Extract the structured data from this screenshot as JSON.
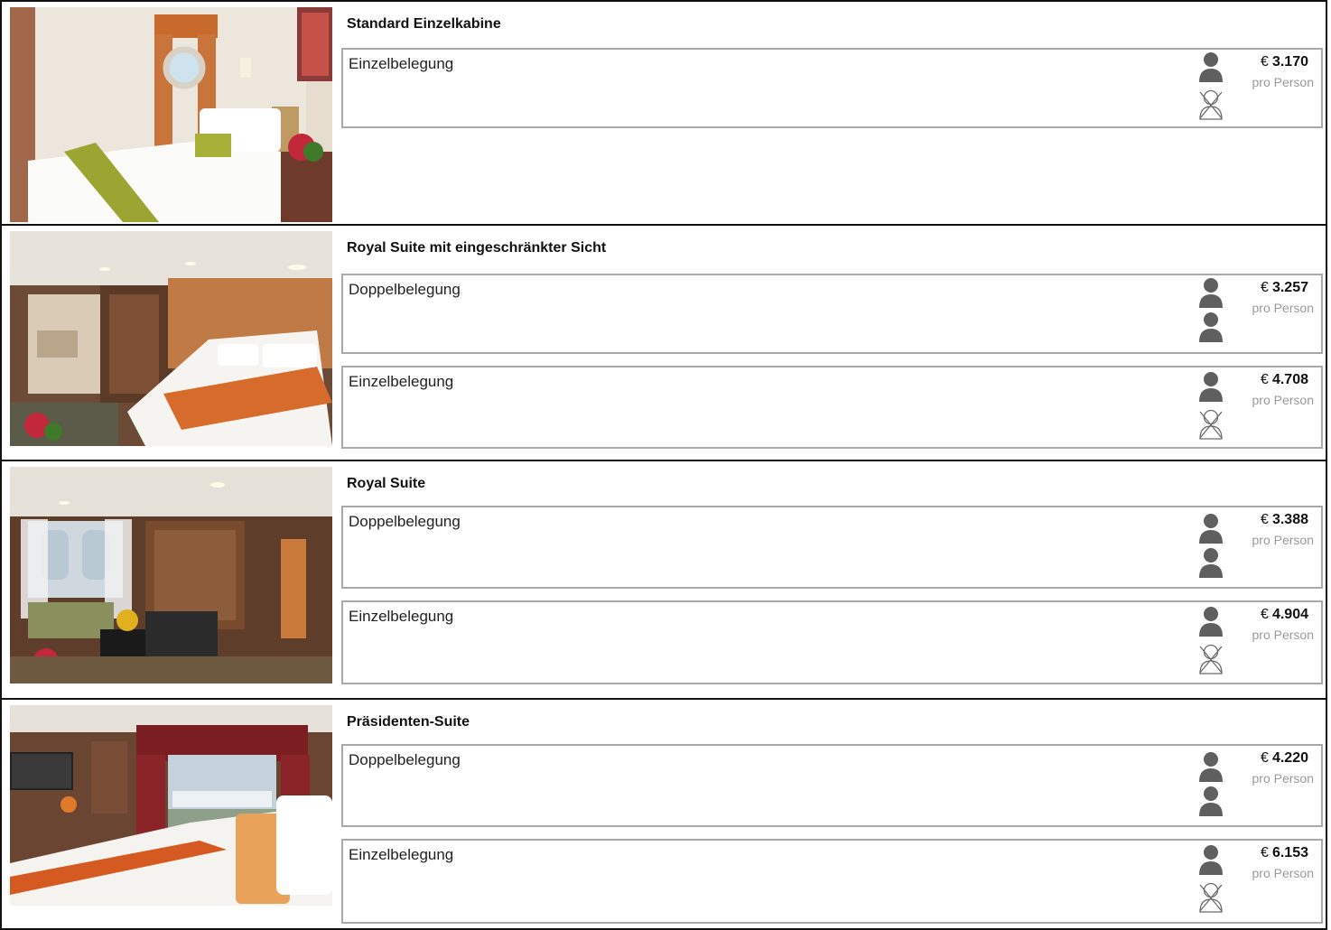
{
  "icons": {
    "person": "person-icon",
    "no_person": "no-person-icon"
  },
  "colors": {
    "person": "#5f5f5f",
    "option_border": "#a9a9a9",
    "per_person": "#9a9a9a"
  },
  "cabins": [
    {
      "title": "Standard Einzelkabine",
      "options": [
        {
          "label": "Einzelbelegung",
          "occupancy": [
            "person",
            "no_person"
          ],
          "currency": "€",
          "price": "3.170",
          "per": "pro Person"
        }
      ]
    },
    {
      "title": "Royal Suite mit eingeschränkter Sicht",
      "options": [
        {
          "label": "Doppelbelegung",
          "occupancy": [
            "person",
            "person"
          ],
          "currency": "€",
          "price": "3.257",
          "per": "pro Person"
        },
        {
          "label": "Einzelbelegung",
          "occupancy": [
            "person",
            "no_person"
          ],
          "currency": "€",
          "price": "4.708",
          "per": "pro Person"
        }
      ]
    },
    {
      "title": "Royal Suite",
      "options": [
        {
          "label": "Doppelbelegung",
          "occupancy": [
            "person",
            "person"
          ],
          "currency": "€",
          "price": "3.388",
          "per": "pro Person"
        },
        {
          "label": "Einzelbelegung",
          "occupancy": [
            "person",
            "no_person"
          ],
          "currency": "€",
          "price": "4.904",
          "per": "pro Person"
        }
      ]
    },
    {
      "title": "Präsidenten-Suite",
      "options": [
        {
          "label": "Doppelbelegung",
          "occupancy": [
            "person",
            "person"
          ],
          "currency": "€",
          "price": "4.220",
          "per": "pro Person"
        },
        {
          "label": "Einzelbelegung",
          "occupancy": [
            "person",
            "no_person"
          ],
          "currency": "€",
          "price": "6.153",
          "per": "pro Person"
        }
      ]
    }
  ]
}
